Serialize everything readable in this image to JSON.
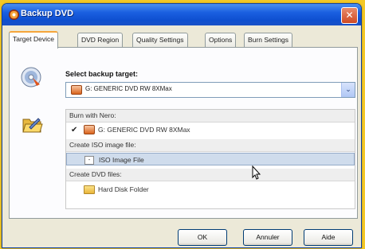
{
  "window": {
    "title": "Backup DVD",
    "close_glyph": "✕"
  },
  "tabs": [
    {
      "label": "Target Device",
      "active": true
    },
    {
      "label": "DVD Region"
    },
    {
      "label": "Quality Settings"
    },
    {
      "label": "Options"
    },
    {
      "label": "Burn Settings"
    }
  ],
  "panel": {
    "select_label": "Select backup target:",
    "combo_value": "G: GENERIC  DVD RW 8XMax",
    "combo_arrow": "⌄",
    "groups": {
      "burn_label": "Burn with Nero:",
      "burn_item": "G: GENERIC  DVD RW 8XMax",
      "burn_check": "✔",
      "iso_label": "Create ISO image file:",
      "iso_item": "ISO Image File",
      "dvd_label": "Create DVD files:",
      "dvd_item": "Hard Disk Folder"
    }
  },
  "buttons": {
    "ok": "OK",
    "cancel": "Annuler",
    "help": "Aide"
  },
  "colors": {
    "accent_tab": "#f6a53a",
    "titlebar": "#1a5fe0",
    "selection": "#cfdcec",
    "background": "#f4c826"
  }
}
